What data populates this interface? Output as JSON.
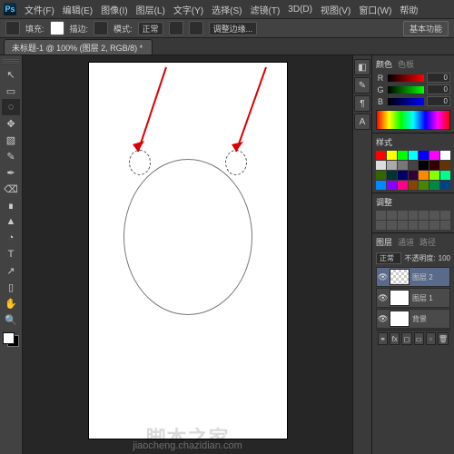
{
  "app": {
    "logo": "Ps"
  },
  "menu": [
    "文件(F)",
    "编辑(E)",
    "图像(I)",
    "图层(L)",
    "文字(Y)",
    "选择(S)",
    "滤镜(T)",
    "3D(D)",
    "视图(V)",
    "窗口(W)",
    "帮助"
  ],
  "options": {
    "fill_label": "填充:",
    "stroke_label": "描边:",
    "mode_label": "模式:",
    "mode_value": "正常",
    "adjust_label": "调整边缘...",
    "btn": "基本功能"
  },
  "tab": {
    "title": "未标题-1 @ 100% (图层 2, RGB/8) *"
  },
  "tools": [
    "↖",
    "▭",
    "◌",
    "✥",
    "▧",
    "✎",
    "✒",
    "⌫",
    "∎",
    "▲",
    "◔",
    "T",
    "↗",
    "▯",
    "✋",
    "🔍"
  ],
  "color": {
    "title": "颜色",
    "tab2": "色板",
    "r": {
      "label": "R",
      "value": "0"
    },
    "g": {
      "label": "G",
      "value": "0"
    },
    "b": {
      "label": "B",
      "value": "0"
    }
  },
  "swatch_colors": [
    "#ff0000",
    "#ffff00",
    "#00ff00",
    "#00ffff",
    "#0000ff",
    "#ff00ff",
    "#ffffff",
    "#dddddd",
    "#aaaaaa",
    "#777777",
    "#444444",
    "#000000",
    "#330000",
    "#663300",
    "#336600",
    "#003333",
    "#000066",
    "#330033",
    "#ff8800",
    "#88ff00",
    "#00ff88",
    "#0088ff",
    "#8800ff",
    "#ff0088",
    "#884400",
    "#448800",
    "#008844",
    "#004488"
  ],
  "style": {
    "title": "样式"
  },
  "adjust": {
    "title": "调整"
  },
  "layers": {
    "tabs": [
      "图层",
      "通道",
      "路径"
    ],
    "mode": "正常",
    "opacity_label": "不透明度:",
    "opacity_value": "100",
    "items": [
      {
        "name": "图层 2",
        "selected": true,
        "trans": true
      },
      {
        "name": "图层 1",
        "selected": false,
        "trans": false
      },
      {
        "name": "背景",
        "selected": false,
        "trans": false
      }
    ]
  },
  "mini_icons": [
    "◧",
    "✎",
    "¶",
    "A"
  ],
  "watermark": "脚本之家",
  "watermark_url": "jiaocheng.chazidian.com"
}
